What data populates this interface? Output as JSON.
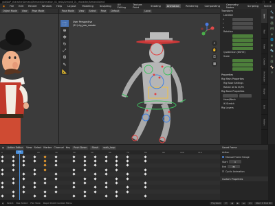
{
  "titlebar": {
    "path": "ypd/AoP_character/Armand/Armand/Animation_01_tests/Armand_01_character/Armand.blend"
  },
  "menubar": {
    "menus": [
      "File",
      "Edit",
      "Render",
      "Window",
      "Help"
    ],
    "workspaces": [
      "Layout",
      "Modeling",
      "Sculpting",
      "UV Editing",
      "Texture Paint",
      "Shading",
      "Animation",
      "Rendering",
      "Compositing",
      "Geometry Nodes",
      "Scripting"
    ],
    "active_workspace": "Animation",
    "scene": "Scene"
  },
  "left_viewport": {
    "mode": "Object Mode",
    "view": "View",
    "overlay": "Pose Mode"
  },
  "main_viewport": {
    "mode": "Pose Mode",
    "menus": [
      "View",
      "Select",
      "Pose"
    ],
    "transform_orientation": "Default",
    "pivot": "Local",
    "info_line1": "User Perspective",
    "info_line2": "(21) rig_jaw_master",
    "gizmo_axes": [
      "X",
      "Y",
      "Z"
    ],
    "tools": [
      "select-icon",
      "cursor-icon",
      "move-icon",
      "rotate-icon",
      "scale-icon",
      "transform-icon",
      "annotate-icon",
      "measure-icon"
    ]
  },
  "npanel": {
    "title": "Transform",
    "location_label": "Location",
    "rotation_label": "Rotation",
    "rotation_mode": "Quaternion (WXYZ)",
    "scale_label": "Scale",
    "axes": [
      "X",
      "Y",
      "Z"
    ],
    "properties": "Properties",
    "rig_main": "Rig Main Properties",
    "rig_base": "Rig Base Settings",
    "rig_ik_fk": "Rotate All to IK/FK",
    "rig_bone": "Rig Bone Properties",
    "sub1": "Head/Neck",
    "sub2": "IK Stretch",
    "rig_layers": "Rig Layers"
  },
  "side_tabs": [
    "Item",
    "Tool",
    "View",
    "Create",
    "Animation",
    "Rigify",
    "Edit",
    "Addon"
  ],
  "action_editor": {
    "menus": [
      "View",
      "Select",
      "Marker",
      "Channel",
      "Key"
    ],
    "mode": "Action Editor",
    "action_name": "walk_loop",
    "push_down": "Push Down",
    "stash": "Stash",
    "frame_ticks": [
      "0",
      "10",
      "20",
      "30",
      "40",
      "50",
      "60",
      "70",
      "80",
      "90",
      "100",
      "110"
    ],
    "current_frame": "21"
  },
  "action_props": {
    "title": "Saved Frame",
    "action_label": "Action",
    "manual_frame_range": "Manual Frame Range",
    "start_label": "Start",
    "end_label": "End",
    "start": "0",
    "end": "80",
    "cyclic": "Cyclic Animation",
    "custom_props": "Custom Properties"
  },
  "statusbar": {
    "select": "Select",
    "box_select": "Box Select",
    "pan": "Pan View",
    "context": "Dope Sheet Context Menu",
    "playback": [
      "Playback",
      "Keying",
      "View",
      "Marker"
    ],
    "frame": "21",
    "start_end": "Start 0  End 80"
  },
  "colors": {
    "accent": "#4772b3",
    "green_field": "#4d7f3b",
    "keyframe": "#e8e8e8",
    "playhead": "#4a8ed8"
  }
}
